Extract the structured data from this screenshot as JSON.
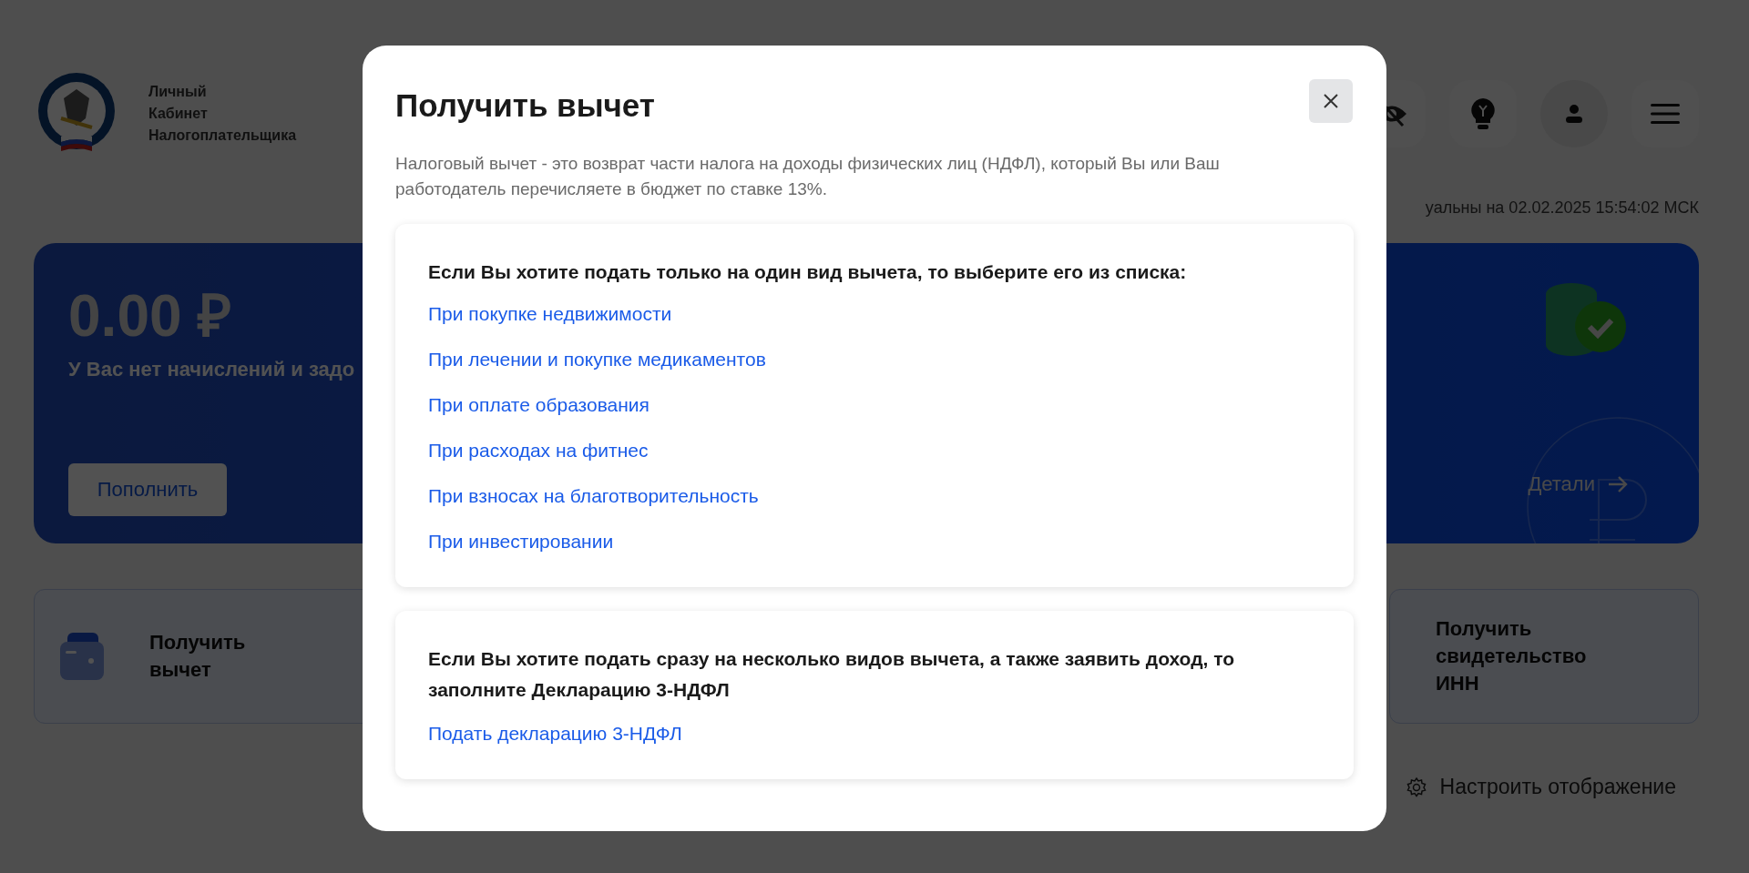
{
  "header": {
    "title_lines": [
      "Личный",
      "Кабинет",
      "Налогоплательщика"
    ],
    "icon_buttons": [
      {
        "kind": "eye-off"
      },
      {
        "kind": "bulb"
      },
      {
        "kind": "user"
      },
      {
        "kind": "menu"
      }
    ]
  },
  "timestamp": "уальны на 02.02.2025 15:54:02 МСК",
  "balance": {
    "amount": "0.00 ₽",
    "message": "У Вас нет начислений и задо",
    "button": "Пополнить",
    "details_link": "Детали"
  },
  "tiles": [
    {
      "kind": "wallet",
      "title": "Получить вычет"
    },
    {
      "kind": "plain",
      "title": "Получить свидетельство ИНН"
    }
  ],
  "settings_link": "Настроить отображение",
  "modal": {
    "title": "Получить вычет",
    "description": "Налоговый вычет - это возврат части налога на доходы физических лиц (НДФЛ), который Вы или Ваш работодатель перечисляете в бюджет по ставке 13%.",
    "sections": [
      {
        "heading": "Если Вы хотите подать только на один вид вычета, то выберите его из списка:",
        "links": [
          "При покупке недвижимости",
          "При лечении и покупке медикаментов",
          "При оплате образования",
          "При расходах на фитнес",
          "При взносах на благотворительность",
          "При инвестировании"
        ]
      },
      {
        "heading": "Если Вы хотите подать сразу на несколько видов вычета, а также заявить доход, то заполните Декларацию 3-НДФЛ",
        "links": [
          "Подать декларацию 3-НДФЛ"
        ]
      }
    ]
  }
}
